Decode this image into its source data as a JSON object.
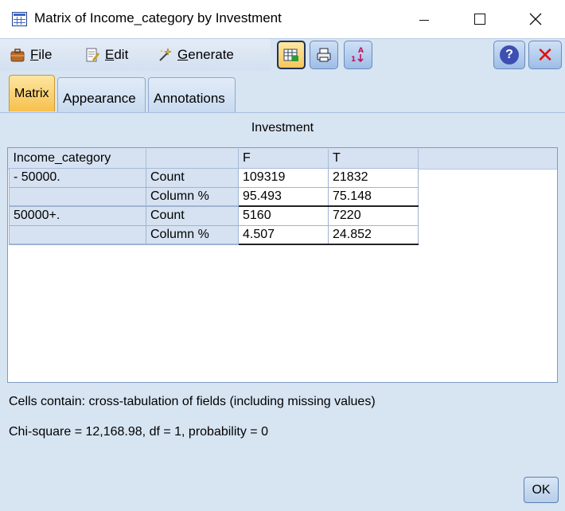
{
  "window": {
    "title": "Matrix of Income_category by Investment"
  },
  "menu": {
    "file_label": "File",
    "file_mnemonic": "F",
    "file_rest": "ile",
    "edit_mnemonic": "E",
    "edit_rest": "dit",
    "generate_mnemonic": "G",
    "generate_rest": "enerate"
  },
  "toolbar": {
    "icons": [
      "table-export-icon",
      "print-icon",
      "sort-icon",
      "help-icon",
      "close-red-icon"
    ]
  },
  "tabs": [
    {
      "label": "Matrix",
      "active": true
    },
    {
      "label": "Appearance",
      "active": false
    },
    {
      "label": "Annotations",
      "active": false
    }
  ],
  "matrix": {
    "column_field": "Investment",
    "header": [
      "Income_category",
      "",
      "F",
      "T"
    ],
    "rows": [
      {
        "category": " - 50000.",
        "stat": "Count",
        "F": "109319",
        "T": "21832"
      },
      {
        "category": "",
        "stat": "Column %",
        "F": "95.493",
        "T": "75.148"
      },
      {
        "category": " 50000+.",
        "stat": "Count",
        "F": "5160",
        "T": "7220"
      },
      {
        "category": "",
        "stat": "Column %",
        "F": "4.507",
        "T": "24.852"
      }
    ]
  },
  "notes": {
    "cells": "Cells contain: cross-tabulation of fields (including missing values)",
    "chi_square": "Chi-square = 12,168.98, df = 1, probability = 0"
  },
  "buttons": {
    "ok": "OK"
  },
  "colors": {
    "panel_bg": "#d7e4f2",
    "active_tab": "#f7c04e",
    "close_red": "#e01010",
    "help_blue": "#3d4fb0"
  }
}
